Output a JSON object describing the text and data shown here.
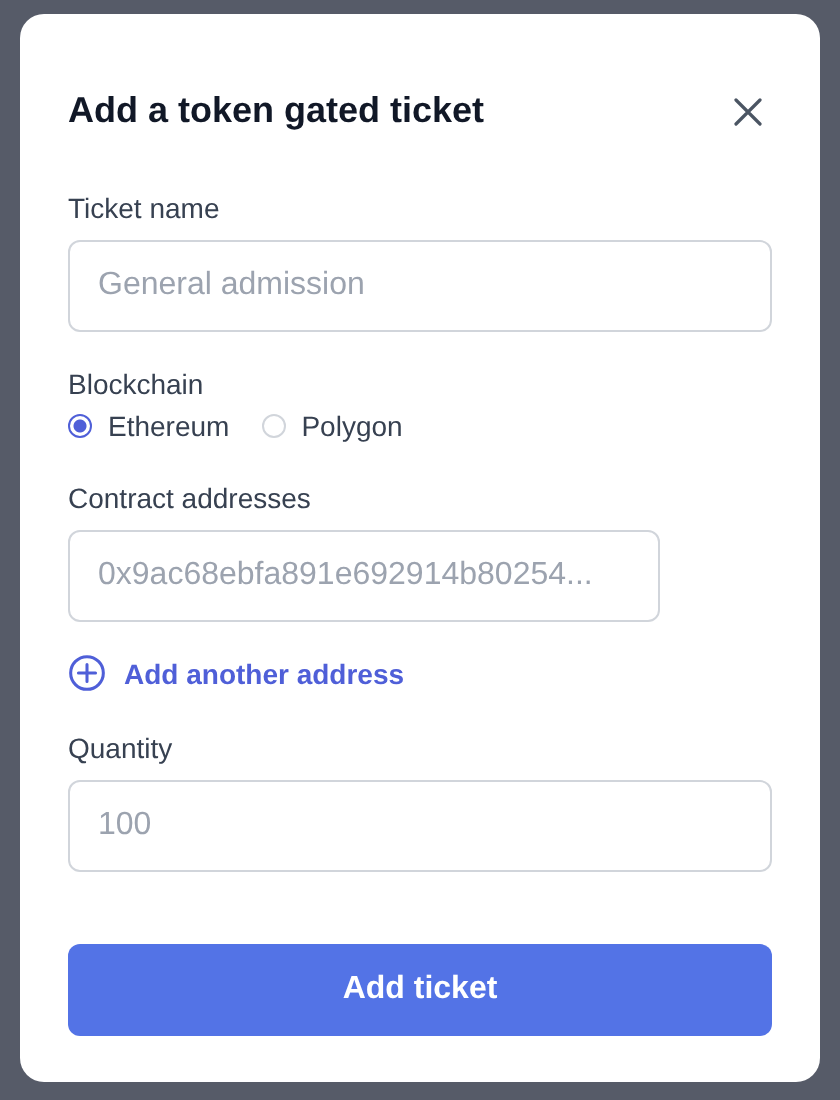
{
  "dialog": {
    "title": "Add a token gated ticket"
  },
  "ticket_name": {
    "label": "Ticket name",
    "placeholder": "General admission"
  },
  "blockchain": {
    "label": "Blockchain",
    "options": [
      {
        "label": "Ethereum",
        "selected": true
      },
      {
        "label": "Polygon",
        "selected": false
      }
    ]
  },
  "contract_addresses": {
    "label": "Contract addresses",
    "placeholder": "0x9ac68ebfa891e692914b80254...",
    "add_link": "Add another address"
  },
  "quantity": {
    "label": "Quantity",
    "placeholder": "100"
  },
  "submit_button": "Add ticket"
}
